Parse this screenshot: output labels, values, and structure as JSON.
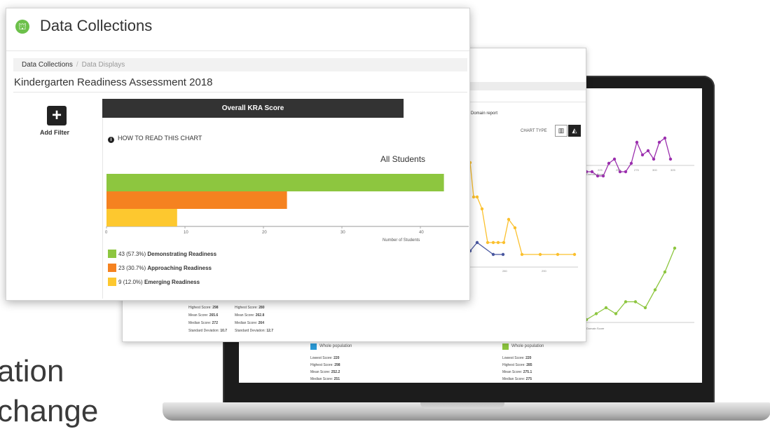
{
  "background": {
    "line1": "ation",
    "line2": "change"
  },
  "laptop": {
    "scatter_top": {
      "x_label": "Domain Score",
      "ticks": [
        "225",
        "250",
        "275",
        "300",
        "325"
      ],
      "color": "#9b2fae",
      "points": [
        [
          0,
          4
        ],
        [
          1,
          4
        ],
        [
          2,
          5
        ],
        [
          3,
          5
        ],
        [
          4,
          2
        ],
        [
          5,
          1
        ],
        [
          6,
          4
        ],
        [
          7,
          4
        ],
        [
          8,
          2
        ],
        [
          9,
          -3
        ],
        [
          10,
          0
        ],
        [
          11,
          -1
        ],
        [
          12,
          1
        ],
        [
          13,
          -3
        ],
        [
          14,
          -4
        ],
        [
          15,
          1
        ]
      ]
    },
    "scatter_bottom": {
      "x_label": "Domain Score",
      "color": "#8dc63f",
      "points": [
        [
          0,
          0
        ],
        [
          1,
          1
        ],
        [
          2,
          2
        ],
        [
          3,
          1
        ],
        [
          4,
          3
        ],
        [
          5,
          3
        ],
        [
          6,
          2
        ],
        [
          7,
          5
        ],
        [
          8,
          8
        ],
        [
          9,
          12
        ]
      ]
    },
    "stats_left": {
      "legend": "Whole population",
      "color": "#2a9bd8",
      "lines": [
        {
          "label": "Lowest Score:",
          "value": "220"
        },
        {
          "label": "Highest Score:",
          "value": "298"
        },
        {
          "label": "Mean Score:",
          "value": "252.2"
        },
        {
          "label": "Median Score:",
          "value": "251"
        }
      ]
    },
    "stats_right": {
      "legend": "Whole population",
      "color": "#8dc63f",
      "lines": [
        {
          "label": "Lowest Score:",
          "value": "220"
        },
        {
          "label": "Highest Score:",
          "value": "285"
        },
        {
          "label": "Mean Score:",
          "value": "275.1"
        },
        {
          "label": "Median Score:",
          "value": "275"
        }
      ]
    }
  },
  "mid_window": {
    "domain_report": "Domain report",
    "chart_type_label": "CHART TYPE",
    "chart_type_options": [
      "bar-chart-icon",
      "area-chart-icon"
    ],
    "line_chart": {
      "orange_color": "#fbc02d",
      "blue_color": "#4a58a0",
      "ticks": [
        "280",
        "290"
      ]
    },
    "stats_a": [
      {
        "label": "Lowest Score:",
        "value": "232"
      },
      {
        "label": "Highest Score:",
        "value": "298"
      },
      {
        "label": "Mean Score:",
        "value": "265.6"
      },
      {
        "label": "Median Score:",
        "value": "272"
      },
      {
        "label": "Standard Deviation:",
        "value": "10.7"
      }
    ],
    "stats_b": [
      {
        "label": "Lowest Score:",
        "value": "232"
      },
      {
        "label": "Highest Score:",
        "value": "280"
      },
      {
        "label": "Mean Score:",
        "value": "262.8"
      },
      {
        "label": "Median Score:",
        "value": "264"
      },
      {
        "label": "Standard Deviation:",
        "value": "12.7"
      }
    ]
  },
  "front_window": {
    "app_title": "Data Collections",
    "breadcrumb": {
      "active": "Data Collections",
      "separator": "/",
      "current": "Data Displays"
    },
    "page_heading": "Kindergarten Readiness Assessment 2018",
    "add_filter_label": "Add Filter",
    "chart_header": "Overall KRA Score",
    "how_to_read": "HOW TO READ THIS CHART",
    "all_students_label": "All Students",
    "legend": [
      {
        "count": "43",
        "pct": "(57.3%)",
        "label": "Demonstrating Readiness",
        "color": "#8dc63f"
      },
      {
        "count": "23",
        "pct": "(30.7%)",
        "label": "Approaching Readiness",
        "color": "#f58220"
      },
      {
        "count": "9",
        "pct": "(12.0%)",
        "label": "Emerging Readiness",
        "color": "#fdc82f"
      }
    ]
  },
  "chart_data": {
    "type": "bar",
    "title": "Overall KRA Score",
    "subtitle": "All Students",
    "xlabel": "Number of Students",
    "xlim": [
      0,
      45
    ],
    "ticks": [
      "0",
      "10",
      "20",
      "30",
      "40"
    ],
    "categories": [
      "Demonstrating Readiness",
      "Approaching Readiness",
      "Emerging Readiness"
    ],
    "values": [
      43,
      23,
      9
    ],
    "colors": [
      "#8dc63f",
      "#f58220",
      "#fdc82f"
    ]
  }
}
